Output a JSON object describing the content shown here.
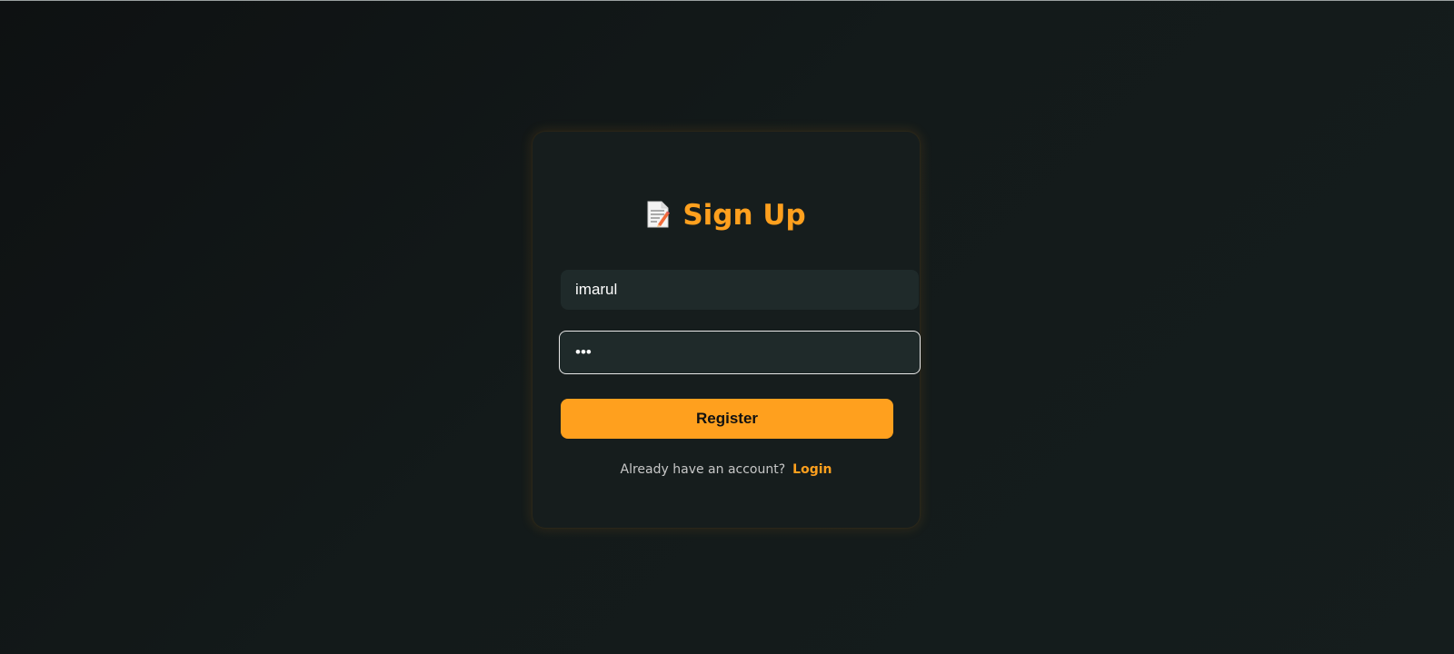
{
  "form": {
    "title": "Sign Up",
    "title_icon": "memo-pencil-icon",
    "username_value": "imarul",
    "password_value": "•••",
    "register_label": "Register",
    "footer_text": "Already have an account?",
    "login_link": "Login"
  },
  "colors": {
    "accent": "#ffa01e",
    "background": "#121818",
    "card": "#161d1d",
    "input": "#1f2a2a"
  }
}
